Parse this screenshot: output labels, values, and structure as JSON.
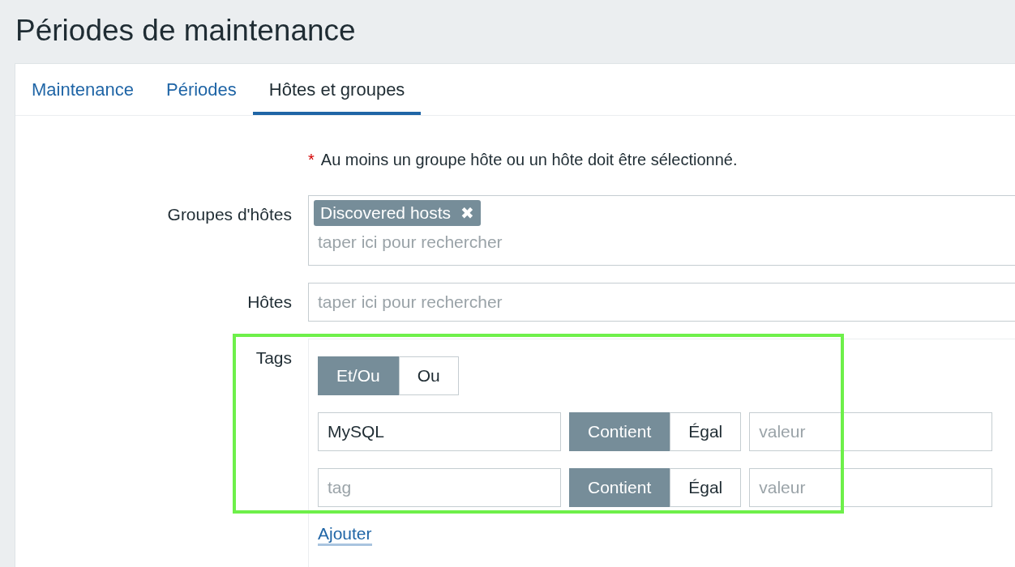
{
  "page_title": "Périodes de maintenance",
  "tabs": [
    {
      "label": "Maintenance",
      "selected": false
    },
    {
      "label": "Périodes",
      "selected": false
    },
    {
      "label": "Hôtes et groupes",
      "selected": true
    }
  ],
  "form": {
    "required_note": {
      "mark": "*",
      "text": "Au moins un groupe hôte ou un hôte doit être sélectionné."
    },
    "host_groups": {
      "label": "Groupes d'hôtes",
      "chips": [
        {
          "label": "Discovered hosts",
          "remove": "✖"
        }
      ],
      "placeholder": "taper ici pour rechercher"
    },
    "hosts": {
      "label": "Hôtes",
      "placeholder": "taper ici pour rechercher"
    },
    "tags": {
      "label": "Tags",
      "highlighted": true,
      "evaltype": [
        {
          "label": "Et/Ou",
          "selected": true
        },
        {
          "label": "Ou",
          "selected": false
        }
      ],
      "rows": [
        {
          "tag": {
            "value": "MySQL"
          },
          "operators": [
            {
              "label": "Contient",
              "selected": true
            },
            {
              "label": "Égal",
              "selected": false
            }
          ],
          "value": {
            "placeholder": "valeur"
          }
        },
        {
          "tag": {
            "placeholder": "tag"
          },
          "operators": [
            {
              "label": "Contient",
              "selected": true
            },
            {
              "label": "Égal",
              "selected": false
            }
          ],
          "value": {
            "placeholder": "valeur"
          }
        }
      ],
      "add_link": "Ajouter"
    }
  }
}
